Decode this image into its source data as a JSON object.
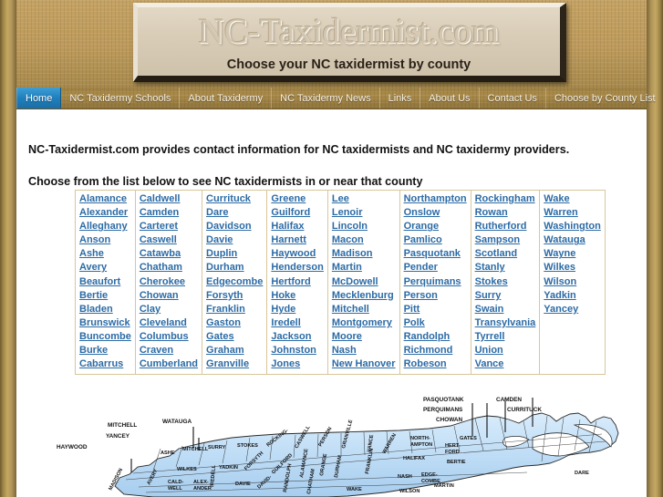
{
  "site": {
    "logo_title": "NC-Taxidermist.com",
    "logo_subtitle": "Choose your NC taxidermist by county"
  },
  "nav": {
    "items": [
      {
        "label": "Home",
        "active": true
      },
      {
        "label": "NC Taxidermy Schools",
        "active": false
      },
      {
        "label": "About Taxidermy",
        "active": false
      },
      {
        "label": "NC Taxidermy News",
        "active": false
      },
      {
        "label": "Links",
        "active": false
      },
      {
        "label": "About Us",
        "active": false
      },
      {
        "label": "Contact Us",
        "active": false
      },
      {
        "label": "Choose by County List",
        "active": false
      }
    ]
  },
  "main": {
    "intro": "NC-Taxidermist.com provides contact information for NC taxidermists and NC taxidermy providers.",
    "choose_prompt": "Choose from the list below to see NC taxidermists in or near that county"
  },
  "county_table": {
    "columns": [
      [
        "Alamance",
        "Alexander",
        "Alleghany",
        "Anson",
        "Ashe",
        "Avery",
        "Beaufort",
        "Bertie",
        "Bladen",
        "Brunswick",
        "Buncombe",
        "Burke",
        "Cabarrus"
      ],
      [
        "Caldwell",
        "Camden",
        "Carteret",
        "Caswell",
        "Catawba",
        "Chatham",
        "Cherokee",
        "Chowan",
        "Clay",
        "Cleveland",
        "Columbus",
        "Craven",
        "Cumberland"
      ],
      [
        "Currituck",
        "Dare",
        "Davidson",
        "Davie",
        "Duplin",
        "Durham",
        "Edgecombe",
        "Forsyth",
        "Franklin",
        "Gaston",
        "Gates",
        "Graham",
        "Granville"
      ],
      [
        "Greene",
        "Guilford",
        "Halifax",
        "Harnett",
        "Haywood",
        "Henderson",
        "Hertford",
        "Hoke",
        "Hyde",
        "Iredell",
        "Jackson",
        "Johnston",
        "Jones"
      ],
      [
        "Lee",
        "Lenoir",
        "Lincoln",
        "Macon",
        "Madison",
        "Martin",
        "McDowell",
        "Mecklenburg",
        "Mitchell",
        "Montgomery",
        "Moore",
        "Nash",
        "New Hanover"
      ],
      [
        "Northampton",
        "Onslow",
        "Orange",
        "Pamlico",
        "Pasquotank",
        "Pender",
        "Perquimans",
        "Person",
        "Pitt",
        "Polk",
        "Randolph",
        "Richmond",
        "Robeson"
      ],
      [
        "Rockingham",
        "Rowan",
        "Rutherford",
        "Sampson",
        "Scotland",
        "Stanly",
        "Stokes",
        "Surry",
        "Swain",
        "Transylvania",
        "Tyrrell",
        "Union",
        "Vance"
      ],
      [
        "Wake",
        "Warren",
        "Washington",
        "Watauga",
        "Wayne",
        "Wilkes",
        "Wilson",
        "Yadkin",
        "Yancey"
      ]
    ]
  },
  "map": {
    "alt": "North Carolina county map",
    "leader_labels": [
      "HAYWOOD",
      "YANCEY",
      "MITCHELL",
      "WATAUGA",
      "PASQUOTANK",
      "PERQUIMANS",
      "CHOWAN",
      "CAMDEN",
      "CURRITUCK"
    ],
    "inline_labels": [
      "ASHE",
      "MITCHELL",
      "SURRY",
      "STOKES",
      "ROCKINGHAM",
      "CASWELL",
      "PERSON",
      "GRANVILLE",
      "VANCE",
      "WARREN",
      "NORTHAMPTON",
      "GATES",
      "HERTFORD",
      "WILKES",
      "YADKIN",
      "FORSYTH",
      "GUILFORD",
      "ALAMANCE",
      "ORANGE",
      "DURHAM",
      "FRANKLIN",
      "HALIFAX",
      "BERTIE",
      "AVERY",
      "CALDWELL",
      "ALEXANDER",
      "IREDELL",
      "DAVIE",
      "DAVIDSON",
      "RANDOLPH",
      "CHATHAM",
      "WAKE",
      "NASH",
      "EDGECOMBE",
      "MARTIN",
      "DARE",
      "WILSON",
      "MADISON"
    ]
  },
  "colors": {
    "brand_tan": "#bd9a5b",
    "nav_active_blue": "#1f7fbd",
    "link_blue": "#2c6ba5",
    "table_border": "#d8c79a",
    "map_fill": "#bfdcf5",
    "page_edge_gold": "#c4a862"
  }
}
